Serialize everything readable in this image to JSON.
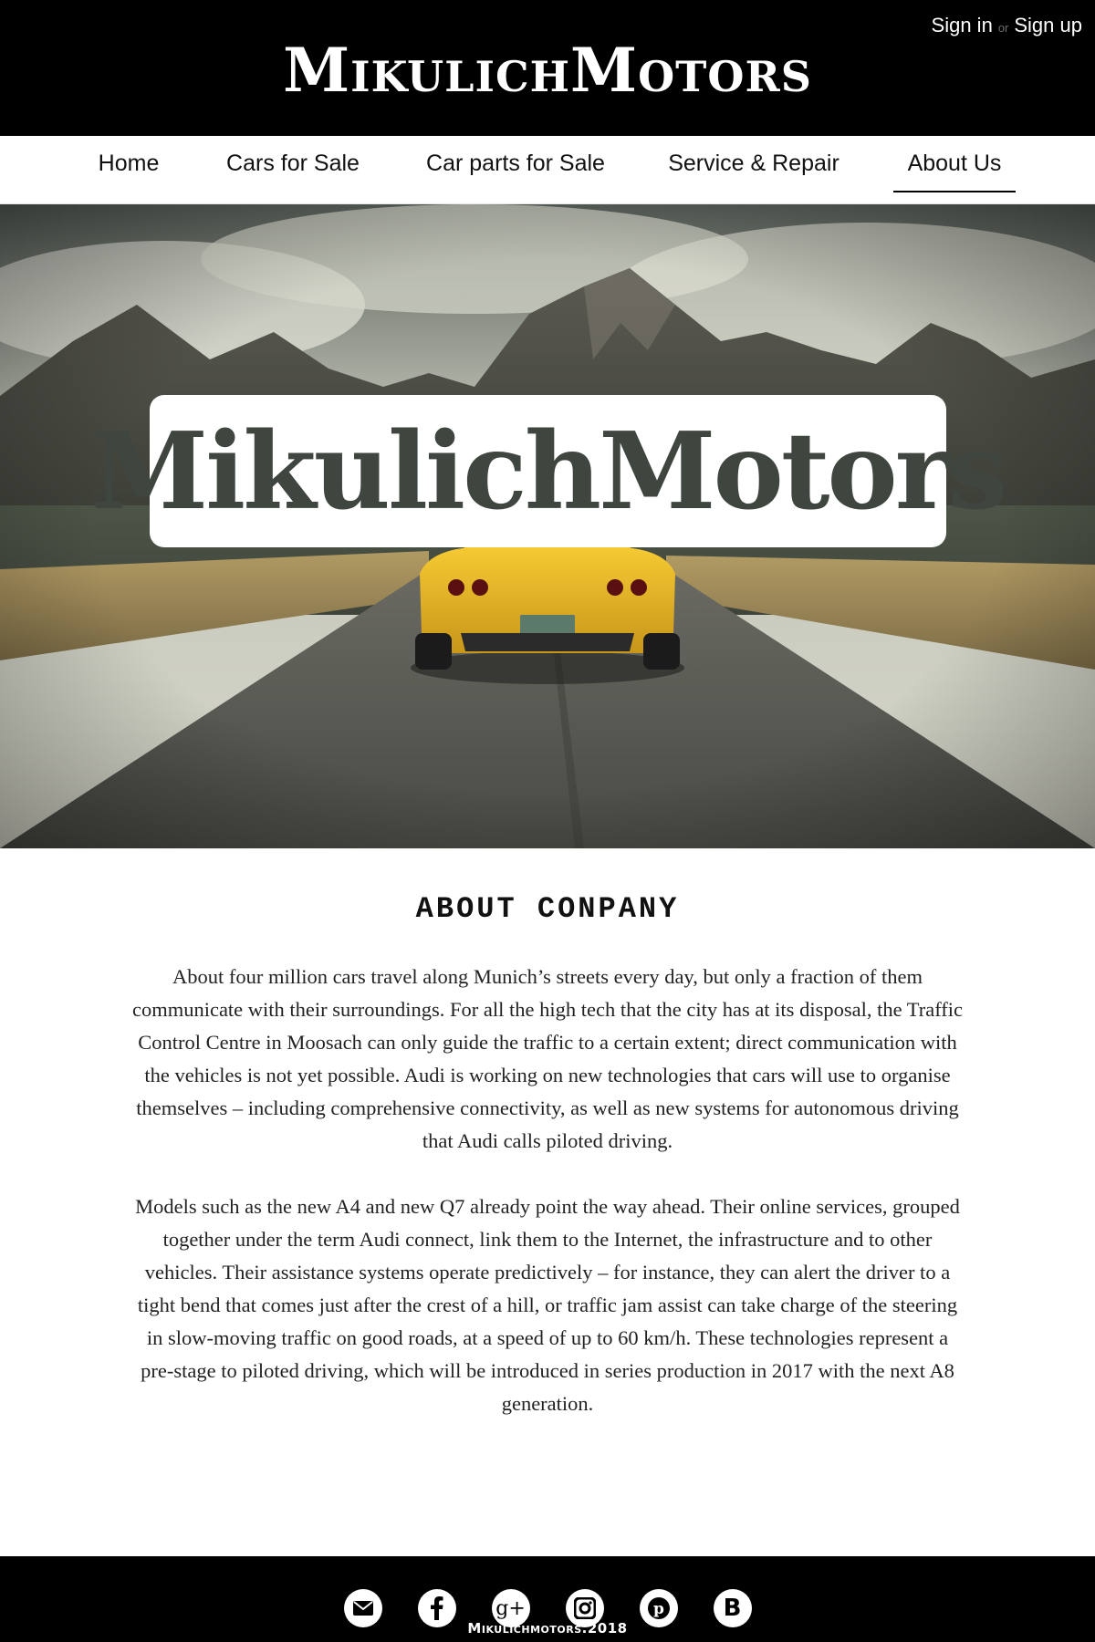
{
  "header": {
    "brand": "MikulichMotors",
    "auth": {
      "sign_in": "Sign in",
      "or": "or",
      "sign_up": "Sign up"
    }
  },
  "nav": {
    "items": [
      {
        "label": "Home"
      },
      {
        "label": "Cars for Sale"
      },
      {
        "label": "Car parts for Sale"
      },
      {
        "label": "Service & Repair"
      },
      {
        "label": "About Us"
      }
    ],
    "active": "About Us"
  },
  "hero": {
    "title": "MikulichMotors",
    "car_plate": "",
    "image_subject": "yellow sports car on desert road with mountains"
  },
  "about": {
    "heading": "ABOUT  CONPANY",
    "paragraphs": [
      "About four million cars travel along Munich’s streets every day, but only a fraction of them communicate with their surroundings. For all the high tech that the city has at its disposal, the Traffic Control Centre in Moosach can only guide the traffic to a certain extent; direct communication with the vehicles is not yet possible. Audi is working on new technologies that cars will use to organise themselves – including comprehensive connectivity, as well as new systems for autonomous driving that Audi calls piloted driving.",
      "Models such as the new A4 and new Q7 already point the way ahead. Their online services, grouped together under the term Audi connect, link them to the Internet, the infrastructure and to other vehicles. Their assistance systems operate predictively – for instance, they can alert the driver to a tight bend that comes just after the crest of a hill, or traffic jam assist can take charge of the steering in slow-moving traffic on good roads, at a speed of up to 60 km/h. These technologies represent a pre-stage to piloted driving, which will be introduced in series production in 2017 with the next A8 generation."
    ]
  },
  "footer": {
    "socials": [
      "mail-icon",
      "facebook-icon",
      "google-plus-icon",
      "instagram-icon",
      "pinterest-icon",
      "blogger-icon"
    ],
    "copyright": "Mikulichmotors.2018"
  },
  "colors": {
    "header_bg": "#000000",
    "footer_bg": "#000000",
    "car_yellow": "#e7b21f"
  }
}
